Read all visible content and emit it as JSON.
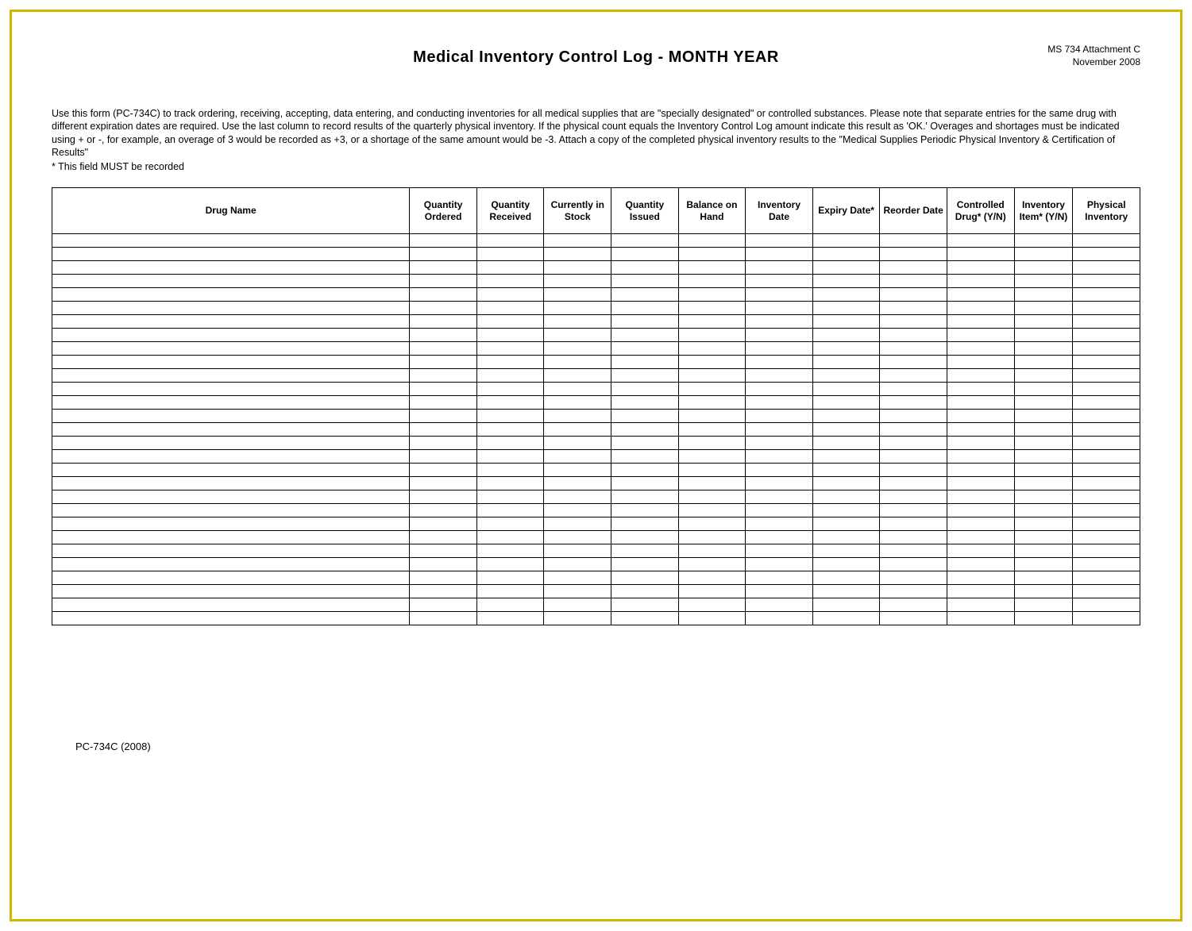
{
  "header": {
    "title": "Medical Inventory Control Log - MONTH YEAR",
    "meta_line1": "MS 734 Attachment C",
    "meta_line2": "November 2008"
  },
  "instructions": {
    "p1": "Use this form (PC-734C) to track ordering, receiving, accepting, data entering, and conducting inventories for all medical supplies that are \"specially designated\" or controlled substances. Please note that separate entries for the same drug with different expiration dates are required. Use the last column to record results of the quarterly physical inventory. If the physical count equals the Inventory Control Log amount indicate this result as 'OK.'  Overages and shortages must be indicated using + or -, for example, an overage of 3 would be recorded as +3, or a shortage of the same amount would be -3. Attach a copy of the completed physical inventory results to the \"Medical Supplies Periodic Physical Inventory & Certification of Results\"",
    "p2": "* This field MUST be recorded"
  },
  "columns": [
    "Drug Name",
    "Quantity Ordered",
    "Quantity Received",
    "Currently in Stock",
    "Quantity Issued",
    "Balance on Hand",
    "Inventory Date",
    "Expiry Date*",
    "Reorder Date",
    "Controlled Drug* (Y/N)",
    "Inventory Item* (Y/N)",
    "Physical Inventory"
  ],
  "row_count": 29,
  "footer": {
    "code": "PC-734C (2008)"
  }
}
